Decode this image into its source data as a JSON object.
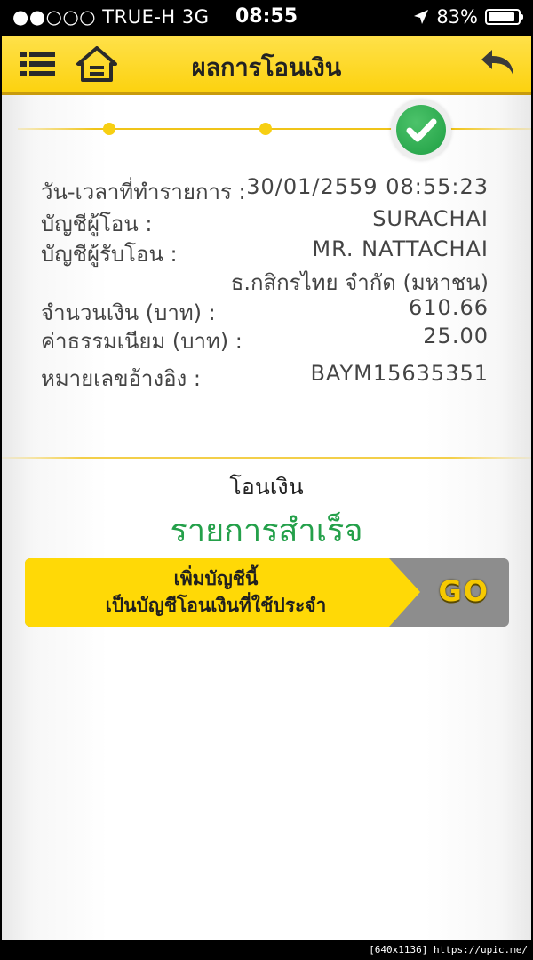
{
  "status_bar": {
    "carrier": "●●○○○ TRUE-H   3G",
    "time": "08:55",
    "battery": "83%"
  },
  "header": {
    "title": "ผลการโอนเงิน"
  },
  "steps": {
    "total": 3,
    "current": 3
  },
  "details": {
    "datetime_label": "วัน-เวลาที่ทำรายการ :",
    "datetime_value": "30/01/2559 08:55:23",
    "from_label": "บัญชีผู้โอน :",
    "from_value": "SURACHAI",
    "to_label": "บัญชีผู้รับโอน :",
    "to_name": "MR. NATTACHAI",
    "to_bank": "ธ.กสิกรไทย จำกัด (มหาชน)",
    "amount_label": "จำนวนเงิน (บาท) :",
    "amount_value": "610.66",
    "fee_label": "ค่าธรรมเนียม (บาท) :",
    "fee_value": "25.00",
    "ref_label": "หมายเลขอ้างอิง :",
    "ref_value": "BAYM15635351"
  },
  "result": {
    "subtitle": "โอนเงิน",
    "status": "รายการสำเร็จ"
  },
  "banner": {
    "line1": "เพิ่มบัญชีนี้",
    "line2": "เป็นบัญชีโอนเงินที่ใช้ประจำ",
    "go_label": "GO"
  },
  "watermark": "[640x1136] https://upic.me/",
  "colors": {
    "header_yellow": "#fcd20f",
    "success_green": "#24a04a",
    "banner_gray": "#8d8d8d"
  }
}
